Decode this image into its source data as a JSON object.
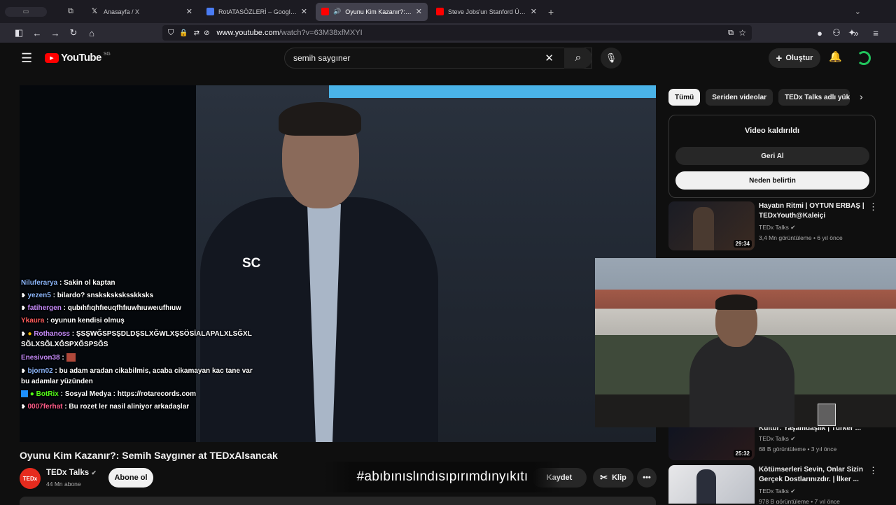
{
  "browser": {
    "tabs": [
      {
        "title": "Anasayfa / X",
        "active": false
      },
      {
        "title": "RotATASÖZLERİ – Google Doküm",
        "active": false
      },
      {
        "title": "Oyunu Kim Kazanır?: Semih",
        "active": true
      },
      {
        "title": "Steve Jobs'un Stanford Üniversit",
        "active": false
      }
    ],
    "url_host": "www.youtube.com",
    "url_path": "/watch?v=63M38xfMXYI"
  },
  "youtube": {
    "logo_text": "YouTube",
    "region": "SG",
    "search_value": "semih saygıner",
    "create_label": "Oluştur"
  },
  "video": {
    "title": "Oyunu Kim Kazanır?: Semih Saygıner at TEDxAlsancak",
    "channel": "TEDx Talks",
    "subscribers": "44 Mn abone",
    "subscribe_label": "Abone ol",
    "save_label": "Kaydet",
    "clip_label": "Klip",
    "watermark": "SC",
    "caption": "#abıbınıslındısıpırımdınyıkıtı"
  },
  "chat": [
    {
      "user": "Niluferarya",
      "msg": ": Sakin ol kaptan",
      "color": "#8ab4f8"
    },
    {
      "user": "yezen5",
      "msg": ": bilardo? snsksksksksskksks",
      "color": "#8ab4f8"
    },
    {
      "user": "fatihergen",
      "msg": ": qubıhfıqhfıeuqfhfıuwhıuweıufhıuw",
      "color": "#c58af9"
    },
    {
      "user": "Ykaura",
      "msg": ": oyunun kendisi olmuş",
      "color": "#ff5c5c"
    },
    {
      "user": "Rothanoss",
      "msg": ": ŞSŞWĞSPSŞDLDŞSLXĞWLXŞSÖSİALAPALXLSĞXLSĞLXSĞLXĞSPXĞSPSĞS",
      "color": "#c58af9"
    },
    {
      "user": "Enesivon38",
      "msg": ":",
      "color": "#c58af9"
    },
    {
      "user": "bjorn02",
      "msg": ": bu adam aradan cikabilmis, acaba cikamayan kac tane var bu adamlar yüzünden",
      "color": "#8ab4f8"
    },
    {
      "user": "BotRix",
      "msg": ": Sosyal Medya : https://rotarecords.com",
      "color": "#53fc18"
    },
    {
      "user": "0007ferhat",
      "msg": ": Bu rozet ler nasil aliniyor arkadaşlar",
      "color": "#ff5c8a"
    }
  ],
  "sidebar": {
    "chips": [
      "Tümü",
      "Seriden videolar",
      "TEDx Talks adlı yükle"
    ],
    "removed_title": "Video kaldırıldı",
    "undo_label": "Geri Al",
    "why_label": "Neden belirtin",
    "recs": [
      {
        "title": "Hayatın Ritmi | OYTUN ERBAŞ | TEDxYouth@Kaleiçi",
        "channel": "TEDx Talks",
        "meta": "3,4 Mn görüntüleme • 6 yıl önce",
        "duration": "29:34"
      },
      {
        "title": "Kültür: Yaşamdaşlık | Türker ...",
        "channel": "TEDx Talks",
        "meta": "68 B görüntüleme • 3 yıl önce",
        "duration": "25:32"
      },
      {
        "title": "Kötümserleri Sevin, Onlar Sizin Gerçek Dostlarınızdır. | İlker ...",
        "channel": "TEDx Talks",
        "meta": "978 B görüntüleme • 7 yıl önce",
        "duration": ""
      }
    ]
  },
  "colors": {
    "yt_red": "#ff0000",
    "page_bg": "#0f0f0f",
    "accent_blue": "#3ea6ff"
  }
}
